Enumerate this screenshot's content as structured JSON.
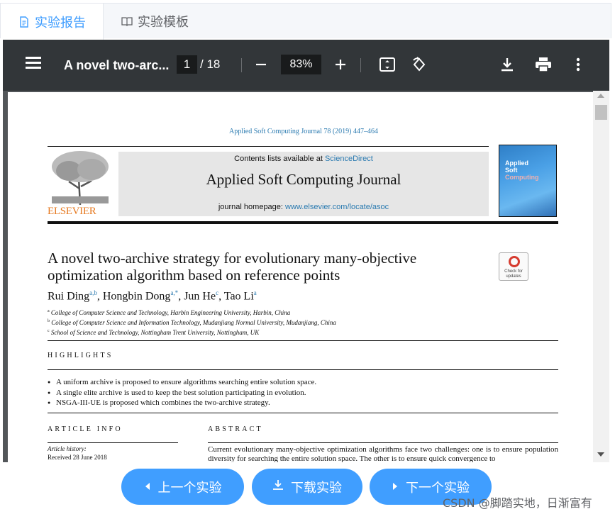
{
  "tabs": [
    {
      "label": "实验报告",
      "icon": "document-icon",
      "active": true
    },
    {
      "label": "实验模板",
      "icon": "book-icon",
      "active": false
    }
  ],
  "toolbar": {
    "doc_title": "A novel two-arc...",
    "page_current": "1",
    "page_total": "/ 18",
    "zoom": "83%"
  },
  "page": {
    "journal_line": "Applied Soft Computing Journal 78 (2019) 447–464",
    "publisher": "ELSEVIER",
    "contents_prefix": "Contents lists available at ",
    "contents_link": "ScienceDirect",
    "journal_name": "Applied Soft Computing Journal",
    "homepage_prefix": "journal homepage: ",
    "homepage_link": "www.elsevier.com/locate/asoc",
    "cover_lines": [
      "Applied",
      "Soft",
      "Computing"
    ],
    "check_updates": "Check for updates",
    "title_line1": "A novel two-archive strategy for evolutionary many-objective",
    "title_line2": "optimization algorithm based on reference points",
    "authors": [
      {
        "name": "Rui Ding",
        "sup": "a,b",
        "sep": ", "
      },
      {
        "name": "Hongbin Dong",
        "sup": "a,*",
        "sep": ", "
      },
      {
        "name": "Jun He",
        "sup": "c",
        "sep": ", "
      },
      {
        "name": "Tao Li",
        "sup": "a",
        "sep": ""
      }
    ],
    "affiliations": [
      {
        "sup": "a",
        "text": "College of Computer Science and Technology, Harbin Engineering University, Harbin, China"
      },
      {
        "sup": "b",
        "text": "College of Computer Science and Information Technology, Mudanjiang Normal University, Mudanjiang, China"
      },
      {
        "sup": "c",
        "text": "School of Science and Technology, Nottingham Trent University, Nottingham, UK"
      }
    ],
    "highlights_head": "HIGHLIGHTS",
    "highlights": [
      "A uniform archive is proposed to ensure algorithms searching entire solution space.",
      "A single elite archive is used to keep the best solution participating in evolution.",
      "NSGA-III-UE is proposed which combines the two-archive strategy."
    ],
    "article_info_head": "ARTICLE INFO",
    "abstract_head": "ABSTRACT",
    "article_history_label": "Article history:",
    "received": "Received 28 June 2018",
    "abstract_text": "Current evolutionary many-objective optimization algorithms face two challenges: one is to ensure population diversity for searching the entire solution space. The other is to ensure quick convergence to"
  },
  "buttons": {
    "prev": "上一个实验",
    "download": "下载实验",
    "next": "下一个实验"
  },
  "watermark": "CSDN @脚踏实地，日渐富有"
}
